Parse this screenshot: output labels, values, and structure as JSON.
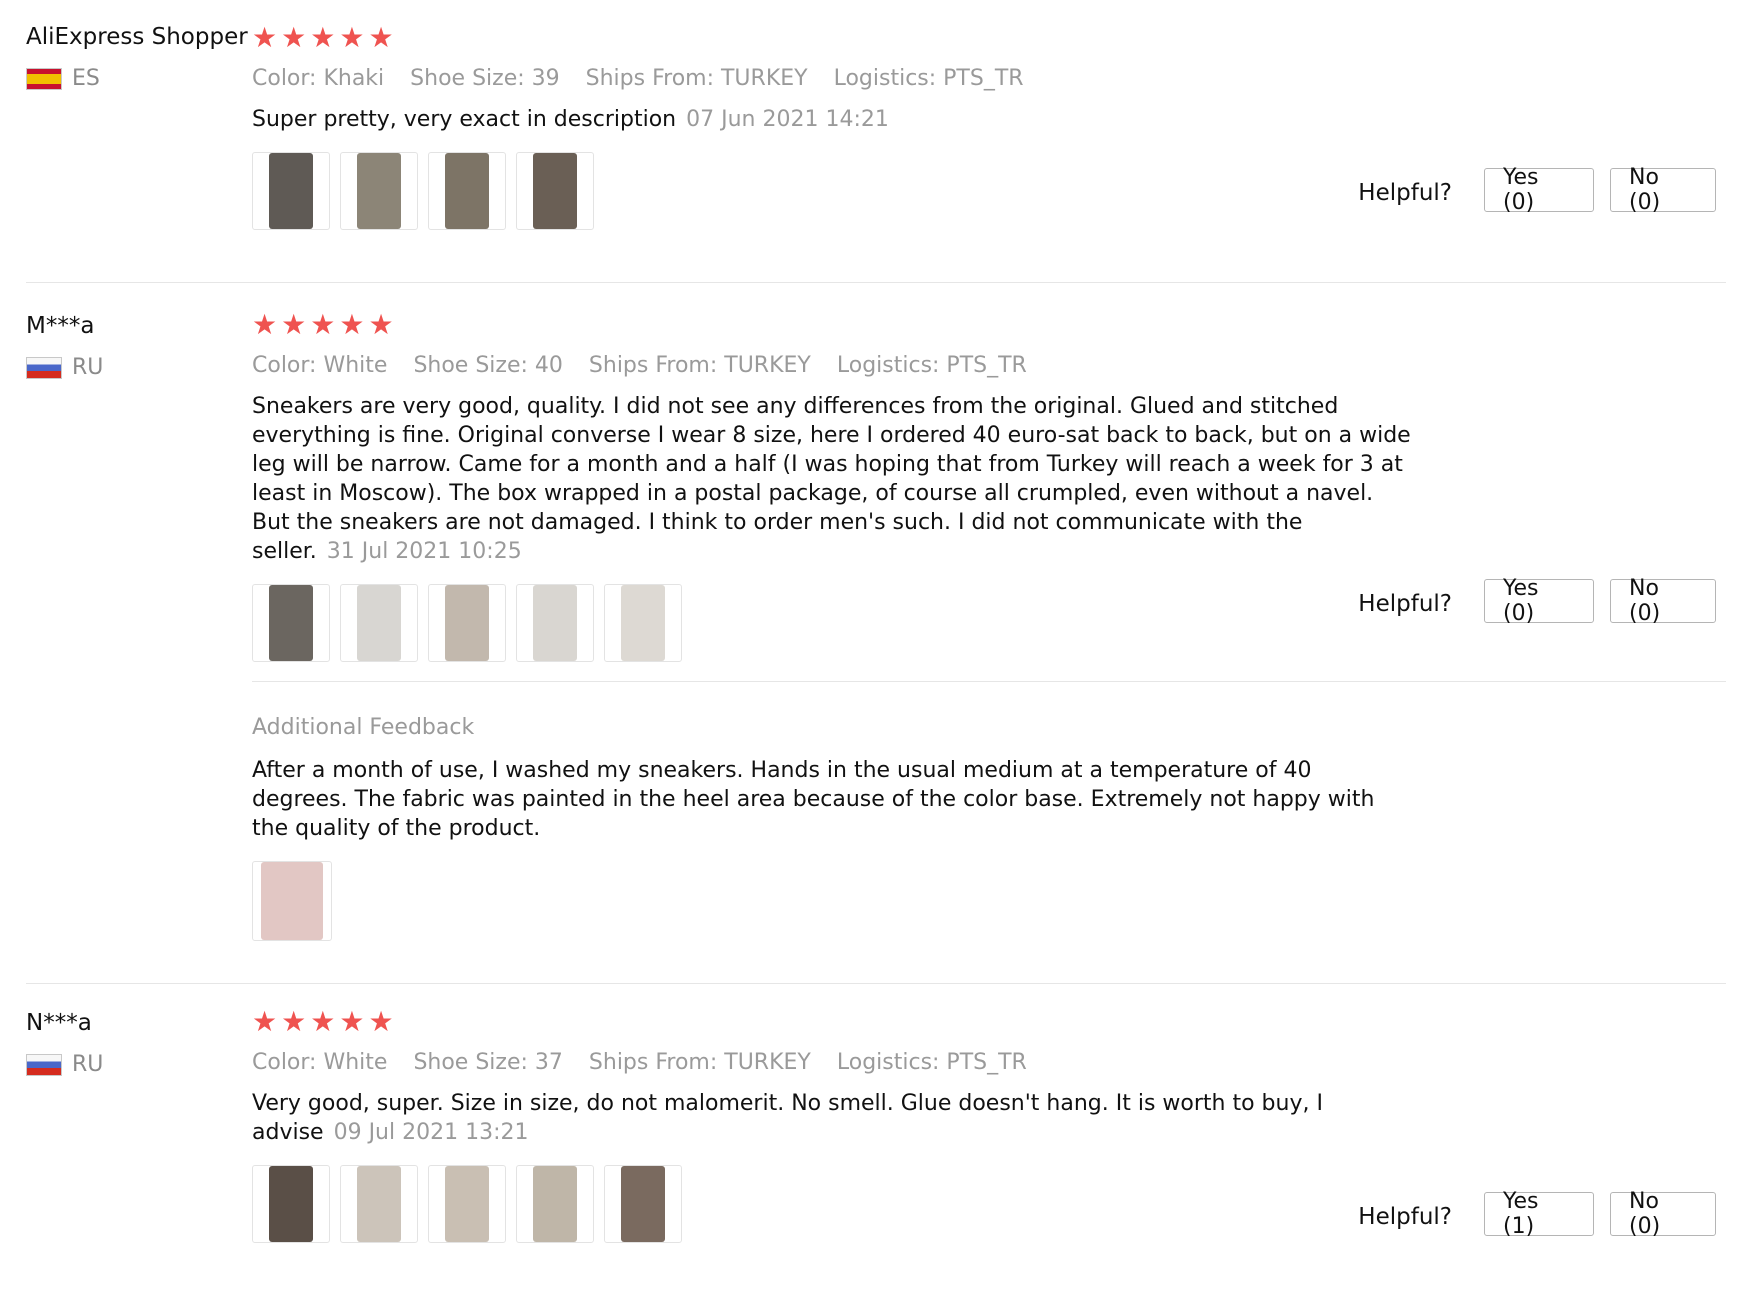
{
  "helpful_label": "Helpful?",
  "reviews": [
    {
      "user": "AliExpress Shopper",
      "country": "ES",
      "rating": 5,
      "attributes": {
        "color": "Color: Khaki",
        "size": "Shoe Size: 39",
        "ships": "Ships From: TURKEY",
        "logistics": "Logistics: PTS_TR"
      },
      "text": "Super pretty, very exact in description",
      "date": "07 Jun 2021 14:21",
      "photos": [
        "#5f5a55",
        "#8c8577",
        "#7d7466",
        "#6a5f55"
      ],
      "yes": "Yes (0)",
      "no": "No (0)"
    },
    {
      "user": "M***a",
      "country": "RU",
      "rating": 5,
      "attributes": {
        "color": "Color: White",
        "size": "Shoe Size: 40",
        "ships": "Ships From: TURKEY",
        "logistics": "Logistics: PTS_TR"
      },
      "text": "Sneakers are very good, quality. I did not see any differences from the original. Glued and stitched everything is fine. Original converse I wear 8 size, here I ordered 40 euro-sat back to back, but on a wide leg will be narrow. Came for a month and a half (I was hoping that from Turkey will reach a week for 3 at least in Moscow). The box wrapped in a postal package, of course all crumpled, even without a navel. But the sneakers are not damaged. I think to order men's such. I did not communicate with the seller.",
      "date": "31 Jul 2021 10:25",
      "photos": [
        "#6b6660",
        "#d8d6d2",
        "#c2b8ad",
        "#d9d6d1",
        "#ddd9d3"
      ],
      "yes": "Yes (0)",
      "no": "No (0)",
      "additional": {
        "title": "Additional Feedback",
        "text": "After a month of use, I washed my sneakers. Hands in the usual medium at a temperature of 40 degrees. The fabric was painted in the heel area because of the color base. Extremely not happy with the quality of the product.",
        "photos": [
          "#e2c7c4"
        ]
      }
    },
    {
      "user": "N***a",
      "country": "RU",
      "rating": 5,
      "attributes": {
        "color": "Color: White",
        "size": "Shoe Size: 37",
        "ships": "Ships From: TURKEY",
        "logistics": "Logistics: PTS_TR"
      },
      "text": "Very good, super. Size in size, do not malomerit. No smell. Glue doesn't hang. It is worth to buy, I advise",
      "date": "09 Jul 2021 13:21",
      "photos": [
        "#5a4f47",
        "#ccc4ba",
        "#c9bfb3",
        "#bfb6a8",
        "#7a6a5f"
      ],
      "yes": "Yes (1)",
      "no": "No (0)"
    }
  ]
}
